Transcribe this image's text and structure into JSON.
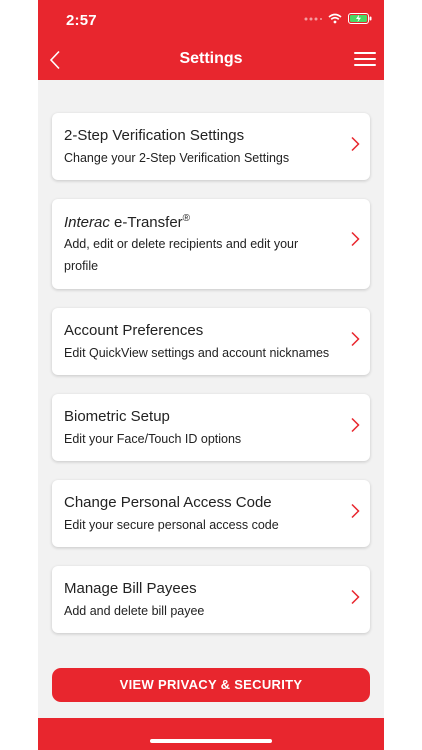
{
  "status_bar": {
    "time": "2:57"
  },
  "nav": {
    "title": "Settings"
  },
  "settings": [
    {
      "title": "2-Step Verification Settings",
      "subtitle": "Change your 2-Step Verification Settings"
    },
    {
      "title_italic": "Interac",
      "title_rest": " e-Transfer",
      "title_sup": "®",
      "subtitle": "Add, edit or delete recipients and edit your profile"
    },
    {
      "title": "Account Preferences",
      "subtitle": "Edit QuickView settings and account nicknames"
    },
    {
      "title": "Biometric Setup",
      "subtitle": "Edit your Face/Touch ID options"
    },
    {
      "title": "Change Personal Access Code",
      "subtitle": "Edit your secure personal access code"
    },
    {
      "title": "Manage Bill Payees",
      "subtitle": "Add and delete bill payee"
    }
  ],
  "cta": {
    "label": "VIEW PRIVACY & SECURITY"
  },
  "colors": {
    "brand_red": "#e8262e",
    "background": "#f2f2f2"
  },
  "icons": [
    "back-chevron-icon",
    "hamburger-menu-icon",
    "chevron-right-icon",
    "wifi-icon",
    "signal-icon",
    "battery-charging-icon"
  ]
}
